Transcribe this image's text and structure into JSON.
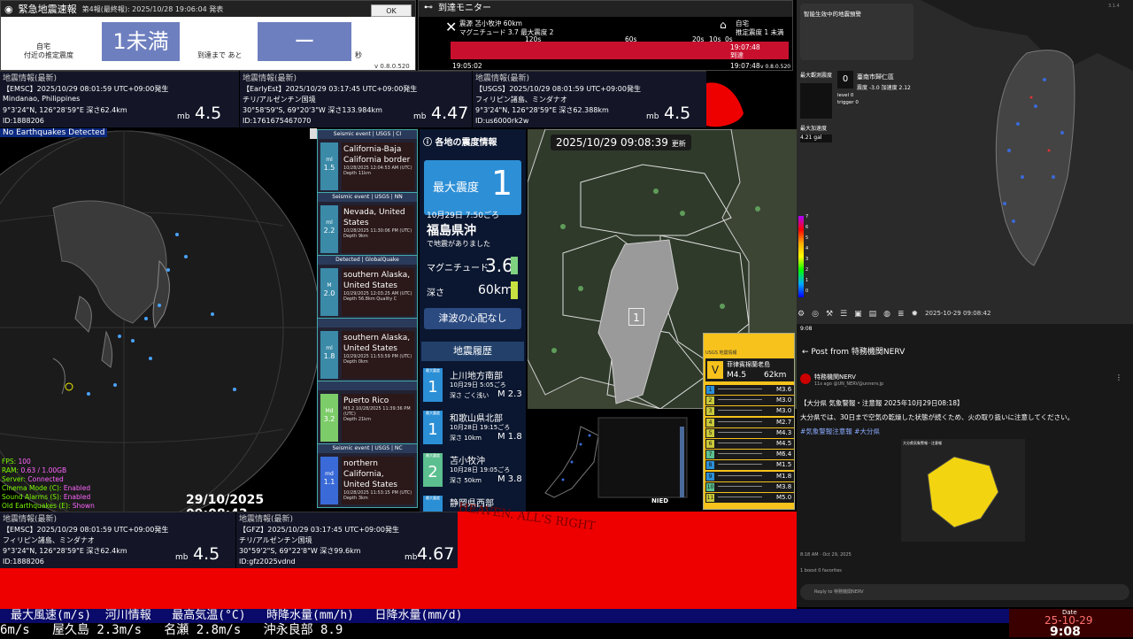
{
  "eew": {
    "title": "緊急地震速報",
    "report": "第4報(最終報): 2025/10/28 19:06:04 発表",
    "ok": "OK",
    "home": "自宅",
    "est_intensity_label": "付近の推定震度",
    "intensity": "1未満",
    "until_label": "到達まで あと",
    "countdown": "ー",
    "unit": "秒",
    "version": "v 0.8.0.520"
  },
  "arrival": {
    "title": "到達モニター",
    "epicenter_label": "震源",
    "epicenter": "苫小牧沖 60km",
    "mag_label": "マグニチュード",
    "magnitude": "3.7",
    "max_int_label": "最大震度",
    "max_intensity": "2",
    "home": "自宅",
    "est_label": "推定震度",
    "est_intensity": "1 未満",
    "scale": [
      "120s",
      "60s",
      "20s",
      "10s",
      "0s"
    ],
    "arrive_time": "19:07:48",
    "arrive_label": "到達",
    "start_time": "19:05:02",
    "end_time": "19:07:48",
    "version": "v 0.8.0.520"
  },
  "quake_top": [
    {
      "title": "地震情報(最新)",
      "line1": "【EMSC】2025/10/29 08:01:59 UTC+09:00発生",
      "line2": "Mindanao, Philippines",
      "line3": "9°3'24\"N, 126°28'59\"E 深さ62.4km",
      "id": "ID:1888206",
      "mb": "mb",
      "mag": "4.5"
    },
    {
      "title": "地震情報(最新)",
      "line1": "【EarlyEst】2025/10/29 03:17:45 UTC+09:00発生",
      "line2": "チリ/アルゼンチン国境",
      "line3": "30°58'59\"S, 69°20'3\"W 深さ133.984km",
      "id": "ID:1761675467070",
      "mb": "mb",
      "mag": "4.47"
    },
    {
      "title": "地震情報(最新)",
      "line1": "【USGS】2025/10/29 08:01:59 UTC+09:00発生",
      "line2": "フィリピン諸島、ミンダナオ",
      "line3": "9°3'24\"N, 126°28'59\"E 深さ62.388km",
      "id": "ID:us6000rk2w",
      "mb": "mb",
      "mag": "4.5"
    }
  ],
  "quake_bottom": [
    {
      "title": "地震情報(最新)",
      "line1": "【EMSC】2025/10/29 08:01:59 UTC+09:00発生",
      "line2": "フィリピン諸島、ミンダナオ",
      "line3": "9°3'24\"N, 126°28'59\"E 深さ62.4km",
      "id": "ID:1888206",
      "mb": "mb",
      "mag": "4.5"
    },
    {
      "title": "地震情報(最新)",
      "line1": "【GFZ】2025/10/29 03:17:45 UTC+09:00発生",
      "line2": "チリ/アルゼンチン国境",
      "line3": "30°59'2\"S, 69°22'8\"W 深さ99.6km",
      "id": "ID:gfz2025vdnd",
      "mb": "mb",
      "mag": "4.67"
    }
  ],
  "globe": {
    "no_eq": "No Earthquakes Detected",
    "timestamp": "29/10/2025 09:08:43",
    "stats": [
      {
        "k": "FPS:",
        "v": "100"
      },
      {
        "k": "RAM:",
        "v": "0.63 / 1.00GB"
      },
      {
        "k": "Server:",
        "v": "Connected"
      },
      {
        "k": "Cinema Mode (C):",
        "v": "Enabled"
      },
      {
        "k": "Sound Alarms (S):",
        "v": "Enabled"
      },
      {
        "k": "Old Earthquakes (E):",
        "v": "Shown"
      }
    ]
  },
  "seismic_cards": [
    {
      "header": "Seismic event | USGS | CI",
      "mtype": "ml",
      "mag": "1.5",
      "name": "California-Baja California border",
      "date": "10/28/2025 12:04:53 AM (UTC)",
      "depth": "Depth 11km",
      "color": "#3a8aa8"
    },
    {
      "header": "Seismic event | USGS | NN",
      "mtype": "ml",
      "mag": "2.2",
      "name": "Nevada, United States",
      "date": "10/28/2025 11:30:06 PM (UTC)",
      "depth": "Depth 9km",
      "color": "#3a8aa8"
    },
    {
      "header": "Detected | GlobalQuake",
      "mtype": "M",
      "mag": "2.0",
      "name": "southern Alaska, United States",
      "date": "10/29/2025 12:03:25 AM (UTC)",
      "depth": "Depth 56.8km  Quality C",
      "color": "#3a8aa8"
    },
    {
      "header": "",
      "mtype": "ml",
      "mag": "1.8",
      "name": "southern Alaska, United States",
      "date": "10/29/2025 11:53:59 PM (UTC)",
      "depth": "Depth 0km",
      "color": "#3a8aa8"
    },
    {
      "header": "",
      "mtype": "Md",
      "mag": "3.2",
      "name": "Puerto Rico",
      "date": "M3.2   10/28/2025 11:39:36 PM (UTC)",
      "depth": "Depth 21km",
      "color": "#7dcc6a"
    },
    {
      "header": "Seismic event | USGS | NC",
      "mtype": "md",
      "mag": "1.1",
      "name": "northern California, United States",
      "date": "10/28/2025 11:53:15 PM (UTC)",
      "depth": "Depth 3km",
      "color": "#3a6ad8"
    }
  ],
  "shindo": {
    "title": "各地の震度情報",
    "max_label": "最大震度",
    "max_value": "1",
    "time": "10月29日 7:50ごろ",
    "region": "福島県沖",
    "occurred": "で地震がありました",
    "mag_label": "マグニチュード",
    "mag": "3.6",
    "depth_label": "深さ",
    "depth": "60km",
    "tsunami": "津波の心配なし",
    "history_title": "地震履歴",
    "history": [
      {
        "int": "1",
        "name": "上川地方南部",
        "time": "10月29日 5:05ごろ",
        "depth": "深さ ごく浅い",
        "mag": "M 2.3"
      },
      {
        "int": "1",
        "name": "和歌山県北部",
        "time": "10月28日 19:15ごろ",
        "depth": "深さ 10km",
        "mag": "M 1.8"
      },
      {
        "int": "2",
        "name": "苫小牧沖",
        "time": "10月28日 19:05ごろ",
        "depth": "深さ 50km",
        "mag": "M 3.8"
      },
      {
        "int": "",
        "name": "静岡県西部",
        "time": "",
        "depth": "",
        "mag": ""
      }
    ],
    "max_small_label": "最大震度"
  },
  "jmap": {
    "datetime": "2025/10/29 09:08:39",
    "update": "更新",
    "marker": "1"
  },
  "smap": {
    "logo": "NIED"
  },
  "usgs": {
    "header": "USGS 地震情報",
    "top_int": "V",
    "top_name": "菲律賓棉蘭老島",
    "top_mag": "M4.5",
    "top_depth": "62km",
    "rows": [
      {
        "n": "1",
        "mag": "M3.6"
      },
      {
        "n": "2",
        "mag": "M3.0"
      },
      {
        "n": "3",
        "mag": "M3.0"
      },
      {
        "n": "4",
        "mag": "M2.7"
      },
      {
        "n": "5",
        "mag": "M4.3"
      },
      {
        "n": "6",
        "mag": "M4.5"
      },
      {
        "n": "7",
        "mag": "M6.4"
      },
      {
        "n": "8",
        "mag": "M1.5"
      },
      {
        "n": "9",
        "mag": "M1.8"
      },
      {
        "n": "10",
        "mag": "M3.8"
      },
      {
        "n": "11",
        "mag": "M5.0"
      }
    ]
  },
  "taiwan": {
    "title": "智能生效中的地震預警",
    "max_label": "最大觀測震度",
    "max_value": "0",
    "station": "臺南市歸仁區",
    "intensity_label": "震度",
    "intensity": "-3.0",
    "accel_label": "加速度",
    "accel": "2.12",
    "level_label": "level",
    "level": "0",
    "trigger_label": "trigger",
    "trigger": "0",
    "max_accel_label": "最大加速度",
    "max_accel": "4.21 gal",
    "timestamp": "2025-10-29 09:08:42",
    "scale": [
      "7",
      "6",
      "5",
      "4",
      "3",
      "2",
      "1",
      "0"
    ],
    "version": "3.1.4"
  },
  "post": {
    "time": "9:08",
    "header": "Post from 特務機関NERV",
    "author": "特務機関NERV",
    "handle": "11s ago @UN_NERV@unnerv.jp",
    "title": "【大分県 気象警報・注意報 2025年10月29日08:18】",
    "body": "大分県では、30日まで空気の乾燥した状態が続くため、火の取り扱いに注意してください。",
    "tags": "#気象警報注意報 #大分県",
    "img_title": "大分県気象警報・注意報",
    "posted": "8:18 AM · Oct 29, 2025",
    "stats": "1 boost   0 favorites",
    "reply": "Reply to 特務機関NERV"
  },
  "banner": {
    "text": "HEAVEN. ALL'S RIGHT"
  },
  "ticker": {
    "top": "最大風速(m/s)  河川情報   最高気温(°C)   時降水量(mm/h)   日降水量(mm/d)",
    "bottom": "6m/s   屋久島 2.3m/s   名瀬 2.8m/s   沖永良部 8.9"
  },
  "clock": {
    "label": "Date",
    "date": "25-10-29",
    "time": "9:08"
  }
}
